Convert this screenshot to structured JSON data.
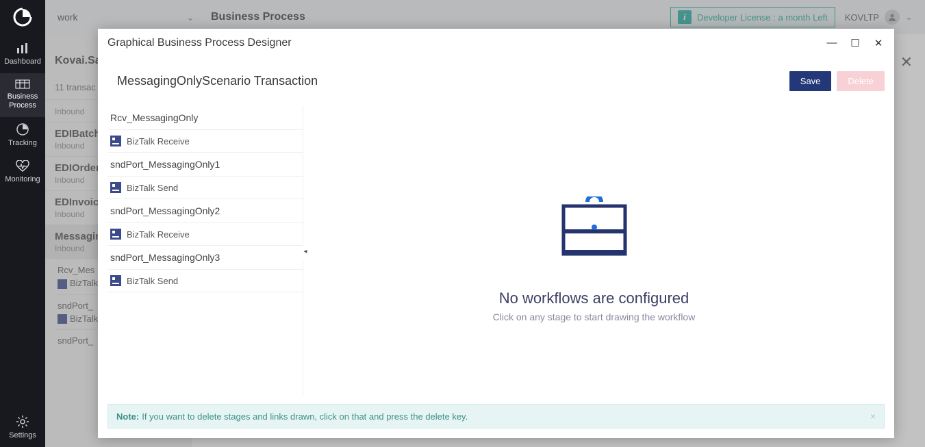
{
  "sidebar": {
    "items": [
      {
        "label": "Dashboard"
      },
      {
        "label": "Business\nProcess"
      },
      {
        "label": "Tracking"
      },
      {
        "label": "Monitoring"
      }
    ],
    "settings_label": "Settings"
  },
  "topbar": {
    "workspace": "work",
    "page_title": "Business Process",
    "license_text": "Developer License : a month Left",
    "user_name": "KOVLTP"
  },
  "bglist": {
    "heading": "Kovai.Sa",
    "count_text": "11 transac",
    "close_label": "✕",
    "items": [
      {
        "title": "",
        "sub": "Inbound"
      },
      {
        "title": "EDIBatch",
        "sub": "Inbound"
      },
      {
        "title": "EDIOrder",
        "sub": "Inbound"
      },
      {
        "title": "EDInvoic",
        "sub": "Inbound"
      },
      {
        "title": "Messagin",
        "sub": "Inbound",
        "active": true
      }
    ],
    "subitems": [
      {
        "name": "Rcv_Mes",
        "type": "BizTalk"
      },
      {
        "name": "sndPort_",
        "type": "BizTalk"
      },
      {
        "name": "sndPort_",
        "type": ""
      }
    ]
  },
  "modal": {
    "title": "Graphical Business Process Designer",
    "transaction_name": "MessagingOnlyScenario Transaction",
    "save_label": "Save",
    "delete_label": "Delete",
    "stages": [
      {
        "name": "Rcv_MessagingOnly",
        "type": "BizTalk Receive"
      },
      {
        "name": "sndPort_MessagingOnly1",
        "type": "BizTalk Send"
      },
      {
        "name": "sndPort_MessagingOnly2",
        "type": "BizTalk Receive"
      },
      {
        "name": "sndPort_MessagingOnly3",
        "type": "BizTalk Send"
      }
    ],
    "empty_title": "No workflows are configured",
    "empty_sub": "Click on any stage to start drawing the workflow",
    "note_label": "Note:",
    "note_text": "If you want to delete stages and links drawn, click on that and press the delete key.",
    "collapse_glyph": "◂"
  }
}
